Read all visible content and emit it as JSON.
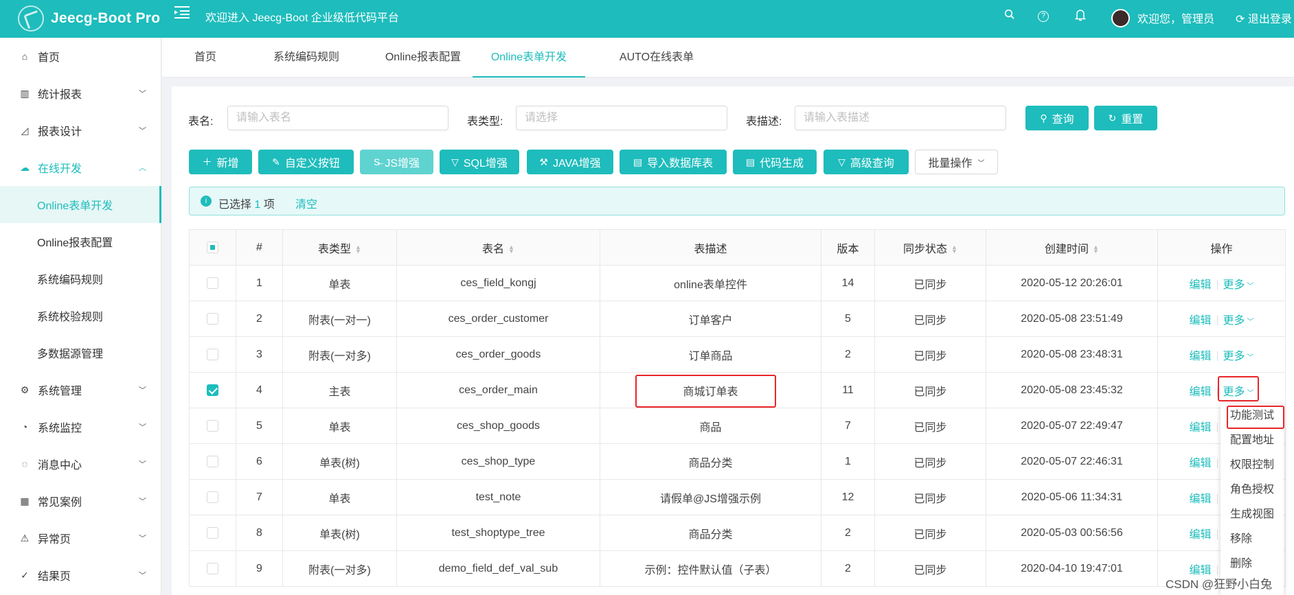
{
  "header": {
    "logo_text": "Jeecg-Boot Pro",
    "welcome": "欢迎进入 Jeecg-Boot 企业级低代码平台",
    "user": "欢迎您，管理员",
    "logout": "退出登录",
    "icons": [
      "search-icon",
      "help-icon",
      "bell-icon"
    ],
    "accent_color": "#1ebcbc"
  },
  "sidebar": {
    "items": [
      {
        "label": "首页",
        "icon": "home-icon"
      },
      {
        "label": "统计报表",
        "icon": "bar-chart-icon"
      },
      {
        "label": "报表设计",
        "icon": "area-chart-icon"
      },
      {
        "label": "在线开发",
        "icon": "cloud-icon"
      },
      {
        "label": "系统管理",
        "icon": "gear-icon"
      },
      {
        "label": "系统监控",
        "icon": "dashboard-icon"
      },
      {
        "label": "消息中心",
        "icon": "message-icon"
      },
      {
        "label": "常见案例",
        "icon": "appstore-icon"
      },
      {
        "label": "异常页",
        "icon": "warning-icon"
      },
      {
        "label": "结果页",
        "icon": "check-circle-icon"
      }
    ],
    "sub_items": [
      "Online表单开发",
      "Online报表配置",
      "系统编码规则",
      "系统校验规则",
      "多数据源管理"
    ]
  },
  "tabs": [
    "首页",
    "系统编码规则",
    "Online报表配置",
    "Online表单开发",
    "AUTO在线表单"
  ],
  "search": {
    "table_name_label": "表名:",
    "table_name_placeholder": "请输入表名",
    "table_type_label": "表类型:",
    "table_type_placeholder": "请选择",
    "table_desc_label": "表描述:",
    "table_desc_placeholder": "请输入表描述",
    "query_btn": "查询",
    "reset_btn": "重置"
  },
  "toolbar": {
    "add": "新增",
    "custom_btn": "自定义按钮",
    "js": "JS增强",
    "sql": "SQL增强",
    "java": "JAVA增强",
    "import_db": "导入数据库表",
    "codegen": "代码生成",
    "adv_query": "高级查询",
    "batch": "批量操作"
  },
  "selection": {
    "prefix": "已选择",
    "count": "1",
    "suffix": "项",
    "clear": "清空"
  },
  "table": {
    "headers": [
      "#",
      "表类型",
      "表名",
      "表描述",
      "版本",
      "同步状态",
      "创建时间",
      "操作"
    ],
    "edit_label": "编辑",
    "more_label": "更多",
    "rows": [
      {
        "idx": "1",
        "type": "单表",
        "name": "ces_field_kongj",
        "desc": "online表单控件",
        "version": "14",
        "status": "已同步",
        "created": "2020-05-12 20:26:01",
        "checked": false
      },
      {
        "idx": "2",
        "type": "附表(一对一)",
        "name": "ces_order_customer",
        "desc": "订单客户",
        "version": "5",
        "status": "已同步",
        "created": "2020-05-08 23:51:49",
        "checked": false
      },
      {
        "idx": "3",
        "type": "附表(一对多)",
        "name": "ces_order_goods",
        "desc": "订单商品",
        "version": "2",
        "status": "已同步",
        "created": "2020-05-08 23:48:31",
        "checked": false
      },
      {
        "idx": "4",
        "type": "主表",
        "name": "ces_order_main",
        "desc": "商城订单表",
        "version": "11",
        "status": "已同步",
        "created": "2020-05-08 23:45:32",
        "checked": true
      },
      {
        "idx": "5",
        "type": "单表",
        "name": "ces_shop_goods",
        "desc": "商品",
        "version": "7",
        "status": "已同步",
        "created": "2020-05-07 22:49:47",
        "checked": false
      },
      {
        "idx": "6",
        "type": "单表(树)",
        "name": "ces_shop_type",
        "desc": "商品分类",
        "version": "1",
        "status": "已同步",
        "created": "2020-05-07 22:46:31",
        "checked": false
      },
      {
        "idx": "7",
        "type": "单表",
        "name": "test_note",
        "desc": "请假单@JS增强示例",
        "version": "12",
        "status": "已同步",
        "created": "2020-05-06 11:34:31",
        "checked": false
      },
      {
        "idx": "8",
        "type": "单表(树)",
        "name": "test_shoptype_tree",
        "desc": "商品分类",
        "version": "2",
        "status": "已同步",
        "created": "2020-05-03 00:56:56",
        "checked": false
      },
      {
        "idx": "9",
        "type": "附表(一对多)",
        "name": "demo_field_def_val_sub",
        "desc": "示例：控件默认值（子表）",
        "version": "2",
        "status": "已同步",
        "created": "2020-04-10 19:47:01",
        "checked": false
      }
    ]
  },
  "more_menu": [
    "功能测试",
    "配置地址",
    "权限控制",
    "角色授权",
    "生成视图",
    "移除",
    "删除"
  ],
  "watermark": "CSDN @狂野小白兔"
}
